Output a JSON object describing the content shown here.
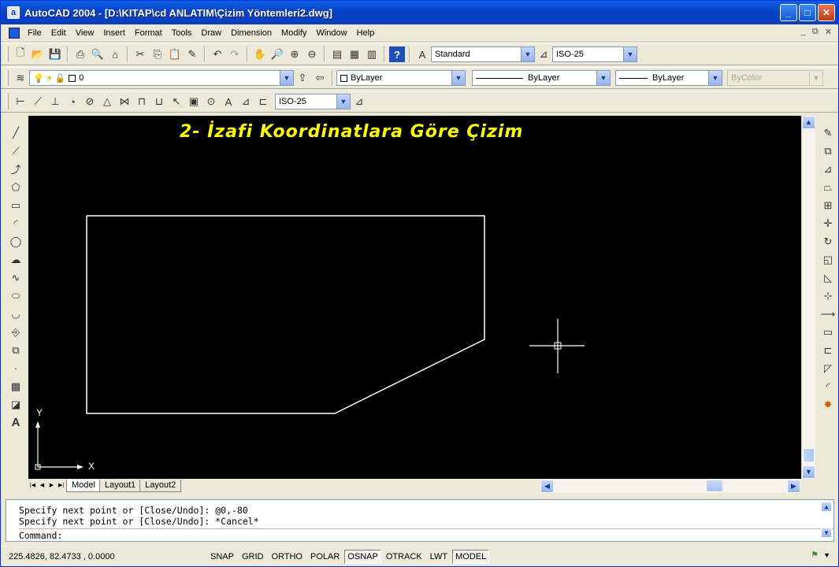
{
  "window": {
    "title": "AutoCAD 2004 - [D:\\KITAP\\cd ANLATIM\\Çizim Yöntemleri2.dwg]",
    "app_icon": "autocad-icon",
    "controls": [
      "minimize-icon",
      "maximize-icon",
      "close-icon"
    ]
  },
  "menu": {
    "items": [
      "File",
      "Edit",
      "View",
      "Insert",
      "Format",
      "Tools",
      "Draw",
      "Dimension",
      "Modify",
      "Window",
      "Help"
    ]
  },
  "toolbars": {
    "text_style": "Standard",
    "dim_style": "ISO-25",
    "layer": "0",
    "color": "ByLayer",
    "linetype": "ByLayer",
    "lineweight": "ByLayer",
    "plot_style": "ByColor",
    "dim_style_2": "ISO-25"
  },
  "drawing": {
    "title": "2- İzafi Koordinatlara Göre Çizim",
    "ucs_y": "Y",
    "ucs_x": "X",
    "line_color": "#ffffff",
    "title_color": "#ffff00"
  },
  "layout_tabs": {
    "items": [
      {
        "label": "Model",
        "active": true
      },
      {
        "label": "Layout1",
        "active": false
      },
      {
        "label": "Layout2",
        "active": false
      }
    ]
  },
  "command": {
    "lines": [
      "Specify next point or [Close/Undo]: @0,-80",
      "Specify next point or [Close/Undo]: *Cancel*"
    ],
    "prompt": "Command:"
  },
  "status": {
    "coords": "225.4826, 82.4733 , 0.0000",
    "buttons": [
      {
        "label": "SNAP",
        "on": false
      },
      {
        "label": "GRID",
        "on": false
      },
      {
        "label": "ORTHO",
        "on": false
      },
      {
        "label": "POLAR",
        "on": false
      },
      {
        "label": "OSNAP",
        "on": true
      },
      {
        "label": "OTRACK",
        "on": false
      },
      {
        "label": "LWT",
        "on": false
      },
      {
        "label": "MODEL",
        "on": true
      }
    ]
  }
}
